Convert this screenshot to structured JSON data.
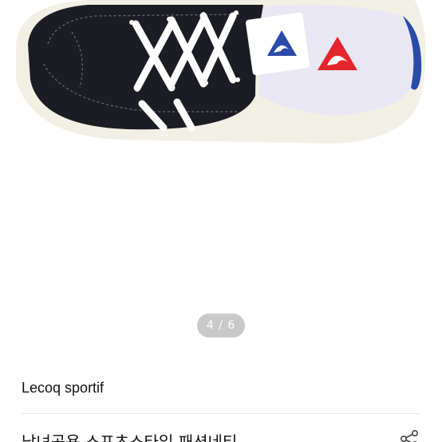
{
  "gallery": {
    "image_alt": "Black canvas Le Coq Sportif sneaker with white laces",
    "logo_text": "le coq sportif",
    "page_indicator": {
      "current": "4",
      "separator": "/",
      "total": "6"
    }
  },
  "product": {
    "brand": "Lecoq sportif",
    "title": "남녀공용 스포츠스타일 패션네티"
  },
  "colors": {
    "shoe_body": "#1c1c24",
    "laces": "#ffffff",
    "sole": "#f2efe4",
    "logo_blue": "#2b4aa8",
    "logo_red": "#e3262c",
    "indicator_bg": "#c9c9c9"
  },
  "icons": {
    "share": "share-icon"
  }
}
